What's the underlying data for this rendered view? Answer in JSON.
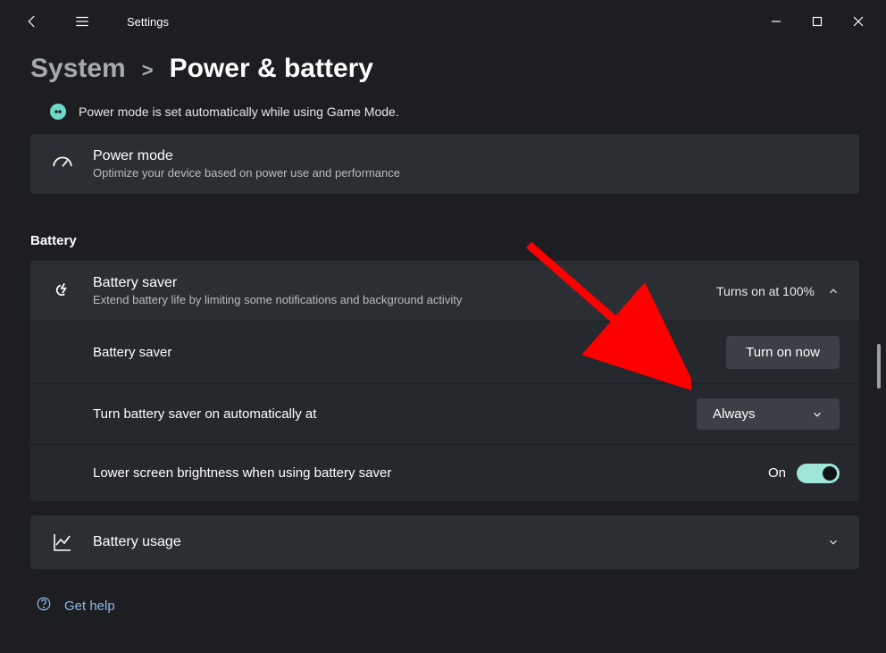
{
  "app_title": "Settings",
  "breadcrumb": {
    "parent": "System",
    "separator": ">",
    "page": "Power & battery"
  },
  "info": {
    "text": "Power mode is set automatically while using Game Mode."
  },
  "power_mode": {
    "title": "Power mode",
    "sub": "Optimize your device based on power use and performance"
  },
  "battery_section_heading": "Battery",
  "battery_saver": {
    "title": "Battery saver",
    "sub": "Extend battery life by limiting some notifications and background activity",
    "status": "Turns on at 100%"
  },
  "rows": {
    "turn_on": {
      "label": "Battery saver",
      "button": "Turn on now"
    },
    "auto": {
      "label": "Turn battery saver on automatically at",
      "select_value": "Always"
    },
    "brightness": {
      "label": "Lower screen brightness when using battery saver",
      "toggle_label": "On"
    }
  },
  "battery_usage": {
    "title": "Battery usage"
  },
  "help": {
    "text": "Get help"
  }
}
